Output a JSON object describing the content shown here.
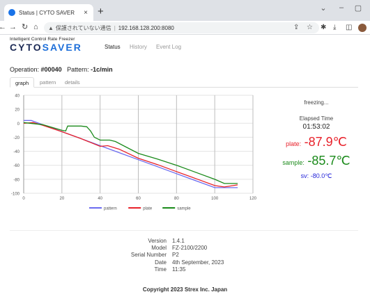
{
  "browser": {
    "tab_title": "Status | CYTO SAVER",
    "close_glyph": "×",
    "new_tab_glyph": "+",
    "security_warning": "保護されていない通信",
    "url": "192.168.128.200:8080"
  },
  "app": {
    "brand_tagline": "Intelligent Control Rate Freezer",
    "brand_left": "CYTO",
    "brand_right": "SAVER",
    "nav": [
      {
        "label": "Status",
        "active": true
      },
      {
        "label": "History",
        "active": false
      },
      {
        "label": "Event Log",
        "active": false
      }
    ]
  },
  "operation": {
    "operation_label": "Operation:",
    "operation_value": "#00040",
    "pattern_label": "Pattern:",
    "pattern_value": "-1c/min"
  },
  "subtabs": [
    {
      "label": "graph",
      "active": true
    },
    {
      "label": "pattern",
      "active": false
    },
    {
      "label": "details",
      "active": false
    }
  ],
  "status": {
    "state": "freezing...",
    "elapsed_label": "Elapsed Time",
    "elapsed_value": "01:53:02",
    "plate_label": "plate:",
    "plate_value": "-87.9℃",
    "sample_label": "sample:",
    "sample_value": "-85.7℃",
    "sv_label": "sv:",
    "sv_value": "-80.0℃",
    "colors": {
      "plate": "#e8212a",
      "sample": "#1a8a1a",
      "sv": "#1f1fd8"
    }
  },
  "chart_data": {
    "type": "line",
    "xlim": [
      0,
      120
    ],
    "ylim": [
      -100,
      40
    ],
    "xticks": [
      0,
      20,
      40,
      60,
      80,
      100,
      120
    ],
    "yticks": [
      40,
      20,
      0,
      -20,
      -40,
      -60,
      -80,
      -100
    ],
    "grid": true,
    "legend_position": "bottom",
    "series": [
      {
        "name": "pattern",
        "color": "#6b6bf0",
        "points": [
          [
            0,
            4
          ],
          [
            4,
            4
          ],
          [
            10,
            -2
          ],
          [
            20,
            -12
          ],
          [
            30,
            -22
          ],
          [
            40,
            -32
          ],
          [
            50,
            -42
          ],
          [
            60,
            -52
          ],
          [
            70,
            -62
          ],
          [
            80,
            -72
          ],
          [
            90,
            -82
          ],
          [
            100,
            -92
          ],
          [
            112,
            -92
          ]
        ]
      },
      {
        "name": "plate",
        "color": "#e8212a",
        "points": [
          [
            0,
            0
          ],
          [
            5,
            1
          ],
          [
            10,
            -3
          ],
          [
            20,
            -12
          ],
          [
            30,
            -22
          ],
          [
            40,
            -33
          ],
          [
            44,
            -32
          ],
          [
            50,
            -37
          ],
          [
            60,
            -50
          ],
          [
            70,
            -59
          ],
          [
            80,
            -69
          ],
          [
            90,
            -79
          ],
          [
            100,
            -89
          ],
          [
            105,
            -91
          ],
          [
            112,
            -88
          ]
        ]
      },
      {
        "name": "sample",
        "color": "#1a8a1a",
        "points": [
          [
            0,
            1
          ],
          [
            10,
            -2
          ],
          [
            20,
            -10
          ],
          [
            22,
            -11
          ],
          [
            23,
            -4
          ],
          [
            30,
            -4
          ],
          [
            33,
            -5
          ],
          [
            35,
            -11
          ],
          [
            37,
            -20
          ],
          [
            40,
            -24
          ],
          [
            45,
            -24
          ],
          [
            48,
            -26
          ],
          [
            60,
            -43
          ],
          [
            70,
            -51
          ],
          [
            80,
            -60
          ],
          [
            90,
            -70
          ],
          [
            100,
            -80
          ],
          [
            105,
            -86
          ],
          [
            112,
            -86
          ]
        ]
      }
    ]
  },
  "info": {
    "rows": [
      {
        "key": "Version",
        "value": "1.4.1"
      },
      {
        "key": "Model",
        "value": "FZ-2100/2200"
      },
      {
        "key": "Serial Number",
        "value": "P2"
      },
      {
        "key": "Date",
        "value": "4th September, 2023"
      },
      {
        "key": "Time",
        "value": "11:35"
      }
    ],
    "copyright": "Copyright 2023 Strex Inc. Japan"
  }
}
